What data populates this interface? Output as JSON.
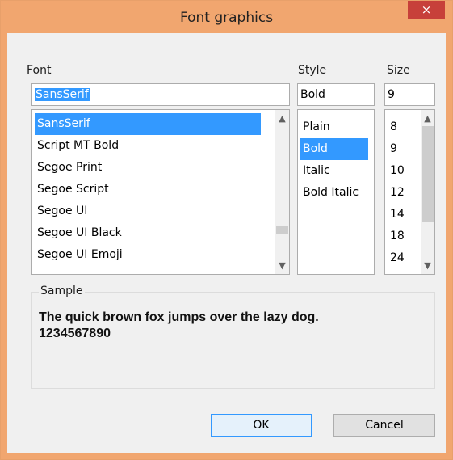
{
  "window": {
    "title": "Font graphics",
    "close_glyph": "×"
  },
  "font": {
    "label": "Font",
    "value": "SansSerif",
    "items": [
      "SansSerif",
      "Script MT Bold",
      "Segoe Print",
      "Segoe Script",
      "Segoe UI",
      "Segoe UI Black",
      "Segoe UI Emoji"
    ],
    "selected_index": 0
  },
  "style": {
    "label": "Style",
    "value": "Bold",
    "items": [
      "Plain",
      "Bold",
      "Italic",
      "Bold Italic"
    ],
    "selected_index": 1
  },
  "size": {
    "label": "Size",
    "value": "9",
    "items": [
      "8",
      "9",
      "10",
      "12",
      "14",
      "18",
      "24"
    ]
  },
  "sample": {
    "label": "Sample",
    "line1": "The quick brown fox jumps over the lazy dog.",
    "line2": "1234567890"
  },
  "buttons": {
    "ok": "OK",
    "cancel": "Cancel"
  },
  "colors": {
    "title_bar": "#f1a66f",
    "close": "#c7403a",
    "selection": "#3399ff"
  }
}
